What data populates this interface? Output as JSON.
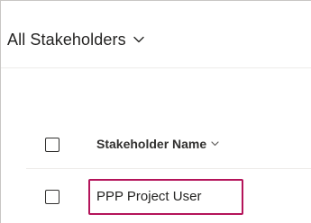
{
  "view": {
    "title": "All Stakeholders",
    "chevron_icon": "chevron-down-icon"
  },
  "grid": {
    "columns": [
      {
        "label": "Stakeholder Name",
        "sort_icon": "chevron-down-icon"
      }
    ],
    "rows": [
      {
        "name": "PPP Project User",
        "highlighted": true
      }
    ]
  },
  "colors": {
    "highlight": "#b4145a",
    "text": "#252423",
    "border": "#c8c6c4"
  }
}
